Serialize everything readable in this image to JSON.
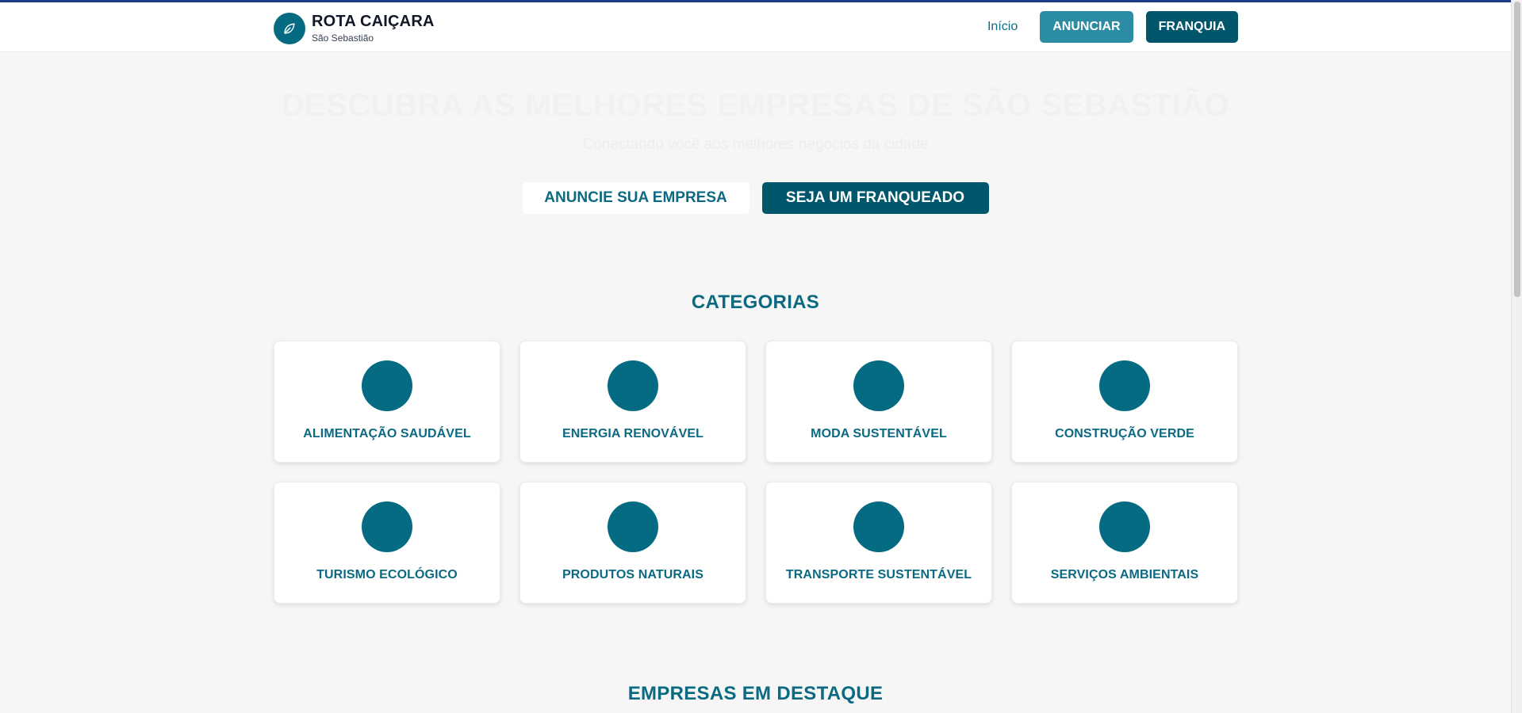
{
  "header": {
    "brand_title": "ROTA CAIÇARA",
    "brand_subtitle": "São Sebastião",
    "logo_icon": "leaf-icon",
    "nav_home": "Início",
    "announce_label": "ANUNCIAR",
    "franchise_label": "FRANQUIA"
  },
  "hero": {
    "title": "DESCUBRA AS MELHORES EMPRESAS DE SÃO SEBASTIÃO",
    "subtitle": "Conectando você aos melhores negócios da cidade",
    "announce_button": "ANUNCIE SUA EMPRESA",
    "franchise_button": "SEJA UM FRANQUEADO"
  },
  "categories": {
    "title": "CATEGORIAS",
    "items": [
      {
        "label": "ALIMENTAÇÃO SAUDÁVEL"
      },
      {
        "label": "ENERGIA RENOVÁVEL"
      },
      {
        "label": "MODA SUSTENTÁVEL"
      },
      {
        "label": "CONSTRUÇÃO VERDE"
      },
      {
        "label": "TURISMO ECOLÓGICO"
      },
      {
        "label": "PRODUTOS NATURAIS"
      },
      {
        "label": "TRANSPORTE SUSTENTÁVEL"
      },
      {
        "label": "SERVIÇOS AMBIENTAIS"
      }
    ]
  },
  "featured": {
    "title": "EMPRESAS EM DESTAQUE"
  },
  "colors": {
    "primary": "#056b82",
    "primary_dark": "#00566b",
    "primary_light": "#2b8ca3",
    "background": "#f6f6f6"
  }
}
